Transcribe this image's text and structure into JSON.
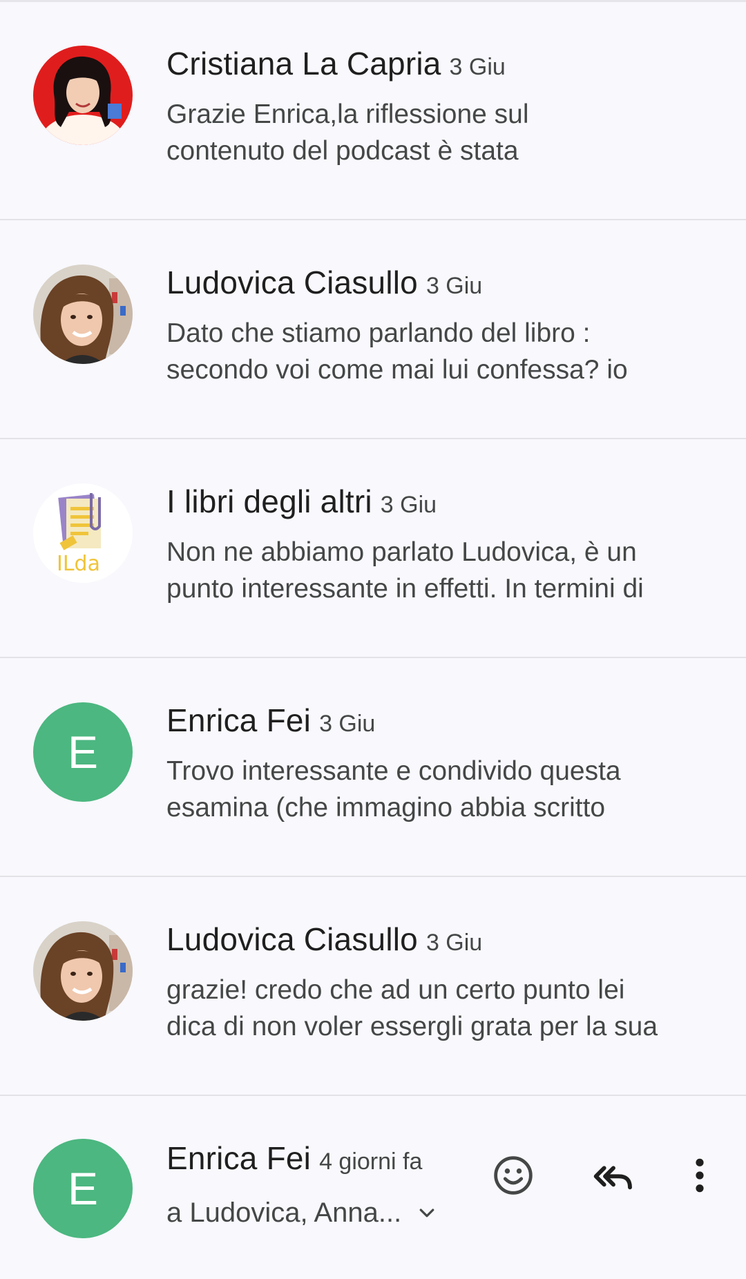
{
  "messages": [
    {
      "sender": "Cristiana La Capria",
      "date": "3 Giu",
      "snippet": [
        "Grazie Enrica,la riflessione sul",
        "contenuto del podcast è stata"
      ],
      "avatar": "photo-red-background"
    },
    {
      "sender": "Ludovica Ciasullo",
      "date": "3 Giu",
      "snippet": [
        "Dato che stiamo parlando del libro :",
        "secondo voi come mai lui confessa? io"
      ],
      "avatar": "photo-woman-curly-hair"
    },
    {
      "sender": "I libri degli altri",
      "date": "3 Giu",
      "snippet": [
        "Non ne abbiamo parlato Ludovica, è un",
        "punto interessante in effetti. In termini di"
      ],
      "avatar": "logo-ilda"
    },
    {
      "sender": "Enrica Fei",
      "date": "3 Giu",
      "snippet": [
        "Trovo interessante e condivido questa",
        "esamina (che immagino abbia scritto"
      ],
      "avatar_letter": "E",
      "avatar_color": "#4cb780"
    },
    {
      "sender": "Ludovica Ciasullo",
      "date": "3 Giu",
      "snippet": [
        "grazie! credo che ad un certo punto lei",
        "dica di non voler essergli grata per la sua"
      ],
      "avatar": "photo-woman-curly-hair"
    }
  ],
  "current_message": {
    "sender": "Enrica Fei",
    "date": "4 giorni fa",
    "recipients": "a Ludovica, Anna...",
    "avatar_letter": "E",
    "avatar_color": "#4cb780",
    "actions": [
      "emoji-reaction-icon",
      "reply-all-icon",
      "more-vert-icon"
    ]
  },
  "colors": {
    "background": "#f8f8fd",
    "accent_green": "#4cb780",
    "icon_gray": "#444746"
  },
  "ilda_logo_text": "ILda"
}
